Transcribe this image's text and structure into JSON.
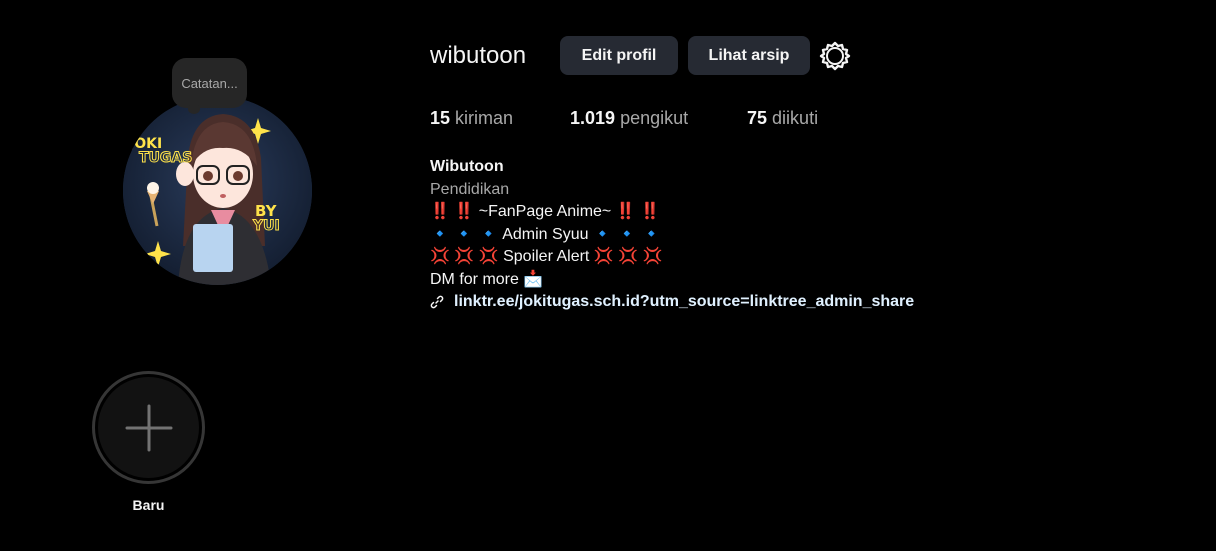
{
  "profile": {
    "username": "wibutoon",
    "note_placeholder": "Catatan...",
    "avatar_text_top": "JOKI",
    "avatar_text_mid": "TUGAS",
    "avatar_text_by": "BY",
    "avatar_text_yui": "YUI"
  },
  "header": {
    "edit_label": "Edit profil",
    "archive_label": "Lihat arsip",
    "settings_icon": "gear-icon"
  },
  "stats": {
    "posts_count": "15",
    "posts_label": "kiriman",
    "followers_count": "1.019",
    "followers_label": "pengikut",
    "following_count": "75",
    "following_label": "diikuti"
  },
  "bio": {
    "name": "Wibutoon",
    "category": "Pendidikan",
    "line1": "‼️ ‼️ ~FanPage Anime~ ‼️ ‼️",
    "line2": "🔹 🔹 🔹 Admin Syuu 🔹 🔹 🔹",
    "line3": "💢 💢 💢 Spoiler Alert 💢 💢 💢",
    "line4": "DM for more 📩",
    "link": "linktr.ee/jokitugas.sch.id?utm_source=linktree_admin_share"
  },
  "highlights": {
    "new_label": "Baru"
  },
  "colors": {
    "background": "#000000",
    "button": "#262a33",
    "muted_text": "#a8a8a8",
    "link": "#e0f1ff"
  }
}
